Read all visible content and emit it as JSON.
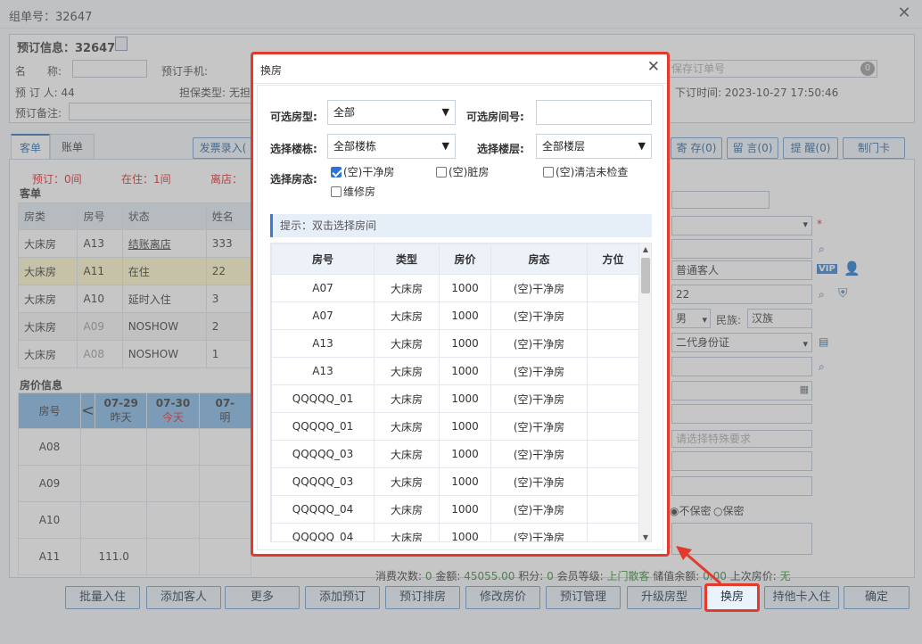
{
  "window": {
    "title": "组单号：32647"
  },
  "order": {
    "heading": "预订信息：32647",
    "name_label": "名　　称:",
    "phone_label": "预订手机:",
    "booker_label": "预 订 人: 44",
    "guarantee_label": "担保类型: 无担",
    "remark_label": "预订备注:",
    "order_no_placeholder": "保存订单号",
    "order_no_badge": "0",
    "order_time": "下订时间: 2023-10-27 17:50:46"
  },
  "tabs": {
    "guest": "客单",
    "bill": "账单"
  },
  "top_buttons": {
    "invoice": "发票录入(",
    "deposit": "寄 存(0)",
    "message": "留 言(0)",
    "reminder": "提 醒(0)",
    "card": "制门卡"
  },
  "stats": {
    "reserved": "预订：0间",
    "inhouse": "在住：1间",
    "left": "离店："
  },
  "guest_list": {
    "title": "客单",
    "headers": [
      "房类",
      "房号",
      "状态",
      "姓名"
    ],
    "rows": [
      [
        "大床房",
        "A13",
        "结账离店",
        "333"
      ],
      [
        "大床房",
        "A11",
        "在住",
        "22"
      ],
      [
        "大床房",
        "A10",
        "延时入住",
        "3"
      ],
      [
        "大床房",
        "A09",
        "NOSHOW",
        "2"
      ],
      [
        "大床房",
        "A08",
        "NOSHOW",
        "1"
      ]
    ]
  },
  "price_info": {
    "title": "房价信息",
    "header_room": "房号",
    "prev_arrow": "<",
    "dates": [
      {
        "date": "07-29",
        "sub": "昨天"
      },
      {
        "date": "07-30",
        "sub": "今天"
      },
      {
        "date": "07-",
        "sub": "明"
      }
    ],
    "rows": [
      {
        "room": "A08",
        "price": ""
      },
      {
        "room": "A09",
        "price": ""
      },
      {
        "room": "A10",
        "price": ""
      },
      {
        "room": "A11",
        "price": "111.0"
      }
    ]
  },
  "right_form": {
    "guest_type": "普通客人",
    "vip": "VIP",
    "name_value": "22",
    "gender": "男",
    "ethnicity_label": "民族:",
    "ethnicity": "汉族",
    "id_type": "二代身份证",
    "special_placeholder": "请选择特殊要求",
    "privacy_no": "不保密",
    "privacy_yes": "保密",
    "required_mark": "*"
  },
  "summary": {
    "consume": "消费次数: ",
    "consume_val": "0",
    "amount": " 金额: ",
    "amount_val": "45055.00",
    "points": " 积分: ",
    "points_val": "0",
    "level": " 会员等级: ",
    "level_val": "上门散客",
    "stored": " 储值余额: ",
    "stored_val": "0.00",
    "last": " 上次房价: ",
    "last_val": "无"
  },
  "bottom_buttons": [
    "批量入住",
    "添加客人",
    "更多",
    "添加预订",
    "预订排房",
    "修改房价",
    "预订管理",
    "升级房型",
    "换房",
    "持他卡入住",
    "确定"
  ],
  "dialog": {
    "title": "换房",
    "room_type_label": "可选房型:",
    "room_type_value": "全部",
    "room_no_label": "可选房间号:",
    "building_label": "选择楼栋:",
    "building_value": "全部楼栋",
    "floor_label": "选择楼层:",
    "floor_value": "全部楼层",
    "status_label": "选择房态:",
    "status_options": [
      {
        "label": "(空)干净房",
        "checked": true
      },
      {
        "label": "(空)脏房",
        "checked": false
      },
      {
        "label": "(空)清洁未检查",
        "checked": false
      },
      {
        "label": "维修房",
        "checked": false
      }
    ],
    "hint": "提示：双击选择房间",
    "headers": [
      "房号",
      "类型",
      "房价",
      "房态",
      "方位"
    ],
    "rows": [
      [
        "A07",
        "大床房",
        "1000",
        "(空)干净房",
        ""
      ],
      [
        "A07",
        "大床房",
        "1000",
        "(空)干净房",
        ""
      ],
      [
        "A13",
        "大床房",
        "1000",
        "(空)干净房",
        ""
      ],
      [
        "A13",
        "大床房",
        "1000",
        "(空)干净房",
        ""
      ],
      [
        "QQQQQ_01",
        "大床房",
        "1000",
        "(空)干净房",
        ""
      ],
      [
        "QQQQQ_01",
        "大床房",
        "1000",
        "(空)干净房",
        ""
      ],
      [
        "QQQQQ_03",
        "大床房",
        "1000",
        "(空)干净房",
        ""
      ],
      [
        "QQQQQ_03",
        "大床房",
        "1000",
        "(空)干净房",
        ""
      ],
      [
        "QQQQQ_04",
        "大床房",
        "1000",
        "(空)干净房",
        ""
      ],
      [
        "QQQQQ_04",
        "大床房",
        "1000",
        "(空)干净房",
        ""
      ]
    ]
  },
  "colors": {
    "highlight": "#e23b2e",
    "accent": "#2a6fb0",
    "summary_green": "#2e8b2e"
  }
}
